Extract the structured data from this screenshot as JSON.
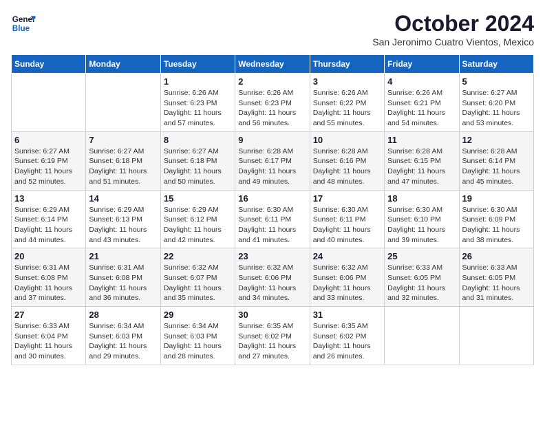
{
  "logo": {
    "line1": "General",
    "line2": "Blue"
  },
  "title": "October 2024",
  "subtitle": "San Jeronimo Cuatro Vientos, Mexico",
  "days_of_week": [
    "Sunday",
    "Monday",
    "Tuesday",
    "Wednesday",
    "Thursday",
    "Friday",
    "Saturday"
  ],
  "weeks": [
    [
      {
        "day": "",
        "info": ""
      },
      {
        "day": "",
        "info": ""
      },
      {
        "day": "1",
        "info": "Sunrise: 6:26 AM\nSunset: 6:23 PM\nDaylight: 11 hours and 57 minutes."
      },
      {
        "day": "2",
        "info": "Sunrise: 6:26 AM\nSunset: 6:23 PM\nDaylight: 11 hours and 56 minutes."
      },
      {
        "day": "3",
        "info": "Sunrise: 6:26 AM\nSunset: 6:22 PM\nDaylight: 11 hours and 55 minutes."
      },
      {
        "day": "4",
        "info": "Sunrise: 6:26 AM\nSunset: 6:21 PM\nDaylight: 11 hours and 54 minutes."
      },
      {
        "day": "5",
        "info": "Sunrise: 6:27 AM\nSunset: 6:20 PM\nDaylight: 11 hours and 53 minutes."
      }
    ],
    [
      {
        "day": "6",
        "info": "Sunrise: 6:27 AM\nSunset: 6:19 PM\nDaylight: 11 hours and 52 minutes."
      },
      {
        "day": "7",
        "info": "Sunrise: 6:27 AM\nSunset: 6:18 PM\nDaylight: 11 hours and 51 minutes."
      },
      {
        "day": "8",
        "info": "Sunrise: 6:27 AM\nSunset: 6:18 PM\nDaylight: 11 hours and 50 minutes."
      },
      {
        "day": "9",
        "info": "Sunrise: 6:28 AM\nSunset: 6:17 PM\nDaylight: 11 hours and 49 minutes."
      },
      {
        "day": "10",
        "info": "Sunrise: 6:28 AM\nSunset: 6:16 PM\nDaylight: 11 hours and 48 minutes."
      },
      {
        "day": "11",
        "info": "Sunrise: 6:28 AM\nSunset: 6:15 PM\nDaylight: 11 hours and 47 minutes."
      },
      {
        "day": "12",
        "info": "Sunrise: 6:28 AM\nSunset: 6:14 PM\nDaylight: 11 hours and 45 minutes."
      }
    ],
    [
      {
        "day": "13",
        "info": "Sunrise: 6:29 AM\nSunset: 6:14 PM\nDaylight: 11 hours and 44 minutes."
      },
      {
        "day": "14",
        "info": "Sunrise: 6:29 AM\nSunset: 6:13 PM\nDaylight: 11 hours and 43 minutes."
      },
      {
        "day": "15",
        "info": "Sunrise: 6:29 AM\nSunset: 6:12 PM\nDaylight: 11 hours and 42 minutes."
      },
      {
        "day": "16",
        "info": "Sunrise: 6:30 AM\nSunset: 6:11 PM\nDaylight: 11 hours and 41 minutes."
      },
      {
        "day": "17",
        "info": "Sunrise: 6:30 AM\nSunset: 6:11 PM\nDaylight: 11 hours and 40 minutes."
      },
      {
        "day": "18",
        "info": "Sunrise: 6:30 AM\nSunset: 6:10 PM\nDaylight: 11 hours and 39 minutes."
      },
      {
        "day": "19",
        "info": "Sunrise: 6:30 AM\nSunset: 6:09 PM\nDaylight: 11 hours and 38 minutes."
      }
    ],
    [
      {
        "day": "20",
        "info": "Sunrise: 6:31 AM\nSunset: 6:08 PM\nDaylight: 11 hours and 37 minutes."
      },
      {
        "day": "21",
        "info": "Sunrise: 6:31 AM\nSunset: 6:08 PM\nDaylight: 11 hours and 36 minutes."
      },
      {
        "day": "22",
        "info": "Sunrise: 6:32 AM\nSunset: 6:07 PM\nDaylight: 11 hours and 35 minutes."
      },
      {
        "day": "23",
        "info": "Sunrise: 6:32 AM\nSunset: 6:06 PM\nDaylight: 11 hours and 34 minutes."
      },
      {
        "day": "24",
        "info": "Sunrise: 6:32 AM\nSunset: 6:06 PM\nDaylight: 11 hours and 33 minutes."
      },
      {
        "day": "25",
        "info": "Sunrise: 6:33 AM\nSunset: 6:05 PM\nDaylight: 11 hours and 32 minutes."
      },
      {
        "day": "26",
        "info": "Sunrise: 6:33 AM\nSunset: 6:05 PM\nDaylight: 11 hours and 31 minutes."
      }
    ],
    [
      {
        "day": "27",
        "info": "Sunrise: 6:33 AM\nSunset: 6:04 PM\nDaylight: 11 hours and 30 minutes."
      },
      {
        "day": "28",
        "info": "Sunrise: 6:34 AM\nSunset: 6:03 PM\nDaylight: 11 hours and 29 minutes."
      },
      {
        "day": "29",
        "info": "Sunrise: 6:34 AM\nSunset: 6:03 PM\nDaylight: 11 hours and 28 minutes."
      },
      {
        "day": "30",
        "info": "Sunrise: 6:35 AM\nSunset: 6:02 PM\nDaylight: 11 hours and 27 minutes."
      },
      {
        "day": "31",
        "info": "Sunrise: 6:35 AM\nSunset: 6:02 PM\nDaylight: 11 hours and 26 minutes."
      },
      {
        "day": "",
        "info": ""
      },
      {
        "day": "",
        "info": ""
      }
    ]
  ]
}
